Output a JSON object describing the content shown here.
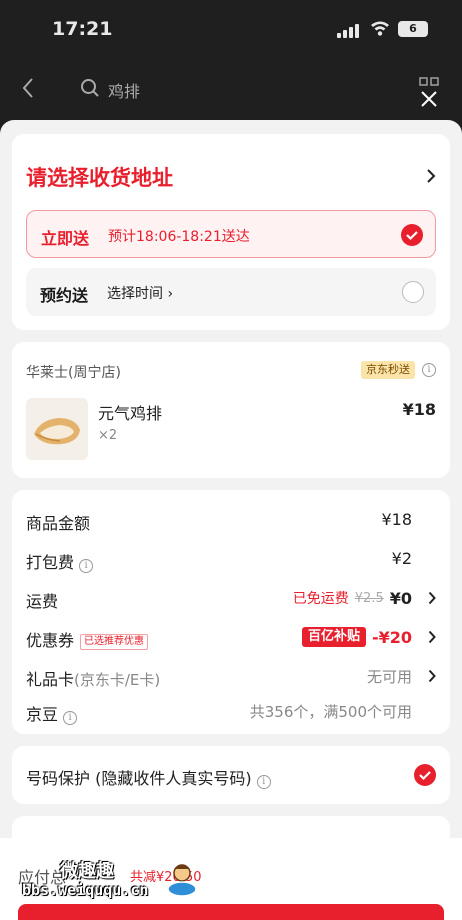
{
  "status_bar": {
    "time": "17:21",
    "battery": "6"
  },
  "background_nav": {
    "search_text": "鸡排"
  },
  "address": {
    "title": "请选择收货地址",
    "instant": {
      "label": "立即送",
      "eta": "预计18:06-18:21送达",
      "selected": true
    },
    "scheduled": {
      "label": "预约送",
      "choose": "选择时间 ›",
      "selected": false
    }
  },
  "shop": {
    "name": "华莱士(周宁店)",
    "badge": "京东秒送",
    "item": {
      "name": "元气鸡排",
      "qty": "×2",
      "price": "¥18"
    }
  },
  "fees": {
    "goods": {
      "label": "商品金额",
      "value": "¥18"
    },
    "packing": {
      "label": "打包费",
      "value": "¥2"
    },
    "shipping": {
      "label": "运费",
      "free_tag": "已免运费",
      "original": "¥2.5",
      "value": "¥0"
    },
    "coupon": {
      "label": "优惠券",
      "recommended_tag": "已选推荐优惠",
      "badge": "百亿补贴",
      "value": "-¥20"
    },
    "giftcard": {
      "label": "礼品卡",
      "sub": "(京东卡/E卡)",
      "value": "无可用"
    },
    "beans": {
      "label": "京豆",
      "value": "共356个，满500个可用"
    }
  },
  "privacy": {
    "label": "号码保护 (隐藏收件人真实号码)",
    "checked": true
  },
  "footer": {
    "due_label": "应付总",
    "saved": "共减¥20.50"
  },
  "watermark": {
    "cn": "微趣趣",
    "url": "bbs.weiququ.cn"
  },
  "colors": {
    "accent": "#e8202d",
    "badge_gold": "#fbe4a9",
    "bg": "#f2f2f2"
  }
}
